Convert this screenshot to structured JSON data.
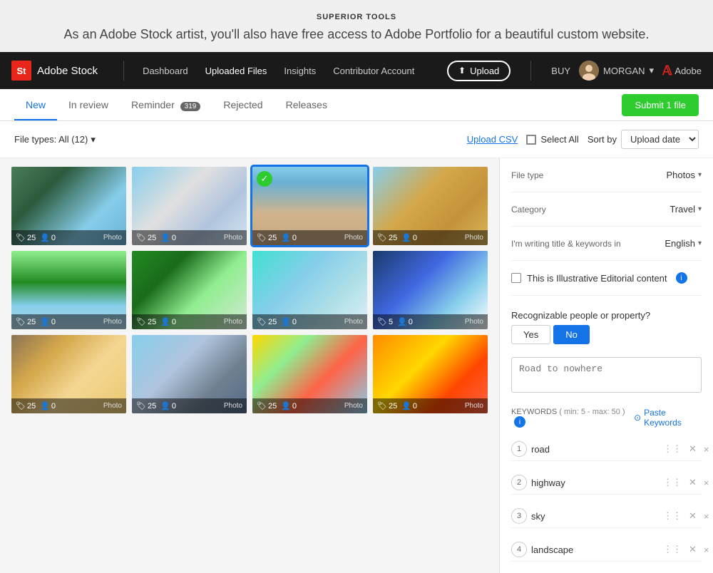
{
  "banner": {
    "site_title": "SUPERIOR TOOLS",
    "promo_text": "As an Adobe Stock artist, you'll also have free access to Adobe Portfolio for a beautiful custom website."
  },
  "navbar": {
    "logo_short": "St",
    "logo_name": "Adobe Stock",
    "nav_links": [
      {
        "label": "Dashboard",
        "active": false
      },
      {
        "label": "Uploaded Files",
        "active": true
      },
      {
        "label": "Insights",
        "active": false
      },
      {
        "label": "Contributor Account",
        "active": false
      }
    ],
    "upload_label": "Upload",
    "buy_label": "BUY",
    "user_name": "MORGAN",
    "adobe_label": "Adobe"
  },
  "tabs": [
    {
      "label": "New",
      "active": true,
      "badge": null
    },
    {
      "label": "In review",
      "active": false,
      "badge": null
    },
    {
      "label": "Reminder",
      "active": false,
      "badge": "319"
    },
    {
      "label": "Rejected",
      "active": false,
      "badge": null
    },
    {
      "label": "Releases",
      "active": false,
      "badge": null
    }
  ],
  "submit_btn": "Submit 1 file",
  "toolbar": {
    "file_types": "File types: All (12)",
    "upload_csv": "Upload CSV",
    "select_all": "Select All",
    "sort_by": "Sort by",
    "sort_option": "Upload date"
  },
  "grid": {
    "items": [
      {
        "id": 1,
        "tags": 25,
        "people": 0,
        "label": "Photo",
        "selected": false,
        "checked": false
      },
      {
        "id": 2,
        "tags": 25,
        "people": 0,
        "label": "Photo",
        "selected": false,
        "checked": false
      },
      {
        "id": 3,
        "tags": 25,
        "people": 0,
        "label": "Photo",
        "selected": true,
        "checked": true
      },
      {
        "id": 4,
        "tags": 25,
        "people": 0,
        "label": "Photo",
        "selected": false,
        "checked": false
      },
      {
        "id": 5,
        "tags": 25,
        "people": 0,
        "label": "Photo",
        "selected": false,
        "checked": false
      },
      {
        "id": 6,
        "tags": 25,
        "people": 0,
        "label": "Photo",
        "selected": false,
        "checked": false
      },
      {
        "id": 7,
        "tags": 25,
        "people": 0,
        "label": "Photo",
        "selected": false,
        "checked": false
      },
      {
        "id": 8,
        "tags": 5,
        "people": 0,
        "label": "Photo",
        "selected": false,
        "checked": false
      },
      {
        "id": 9,
        "tags": 25,
        "people": 0,
        "label": "Photo",
        "selected": false,
        "checked": false
      },
      {
        "id": 10,
        "tags": 25,
        "people": 0,
        "label": "Photo",
        "selected": false,
        "checked": false
      },
      {
        "id": 11,
        "tags": 25,
        "people": 0,
        "label": "Photo",
        "selected": false,
        "checked": false
      },
      {
        "id": 12,
        "tags": 25,
        "people": 0,
        "label": "Photo",
        "selected": false,
        "checked": false
      }
    ]
  },
  "sidebar": {
    "file_type_label": "File type",
    "file_type_value": "Photos",
    "category_label": "Category",
    "category_value": "Travel",
    "writing_label": "I'm writing title & keywords in",
    "writing_value": "English",
    "editorial_label": "This is Illustrative Editorial content",
    "recognizable_label": "Recognizable people or property?",
    "yes_label": "Yes",
    "no_label": "No",
    "title_placeholder": "Road to nowhere",
    "keywords_label": "KEYWORDS",
    "keywords_hint": "min: 5 - max: 50",
    "paste_keywords": "Paste Keywords",
    "keywords": [
      {
        "num": 1,
        "value": "road"
      },
      {
        "num": 2,
        "value": "highway"
      },
      {
        "num": 3,
        "value": "sky"
      },
      {
        "num": 4,
        "value": "landscape"
      }
    ]
  }
}
